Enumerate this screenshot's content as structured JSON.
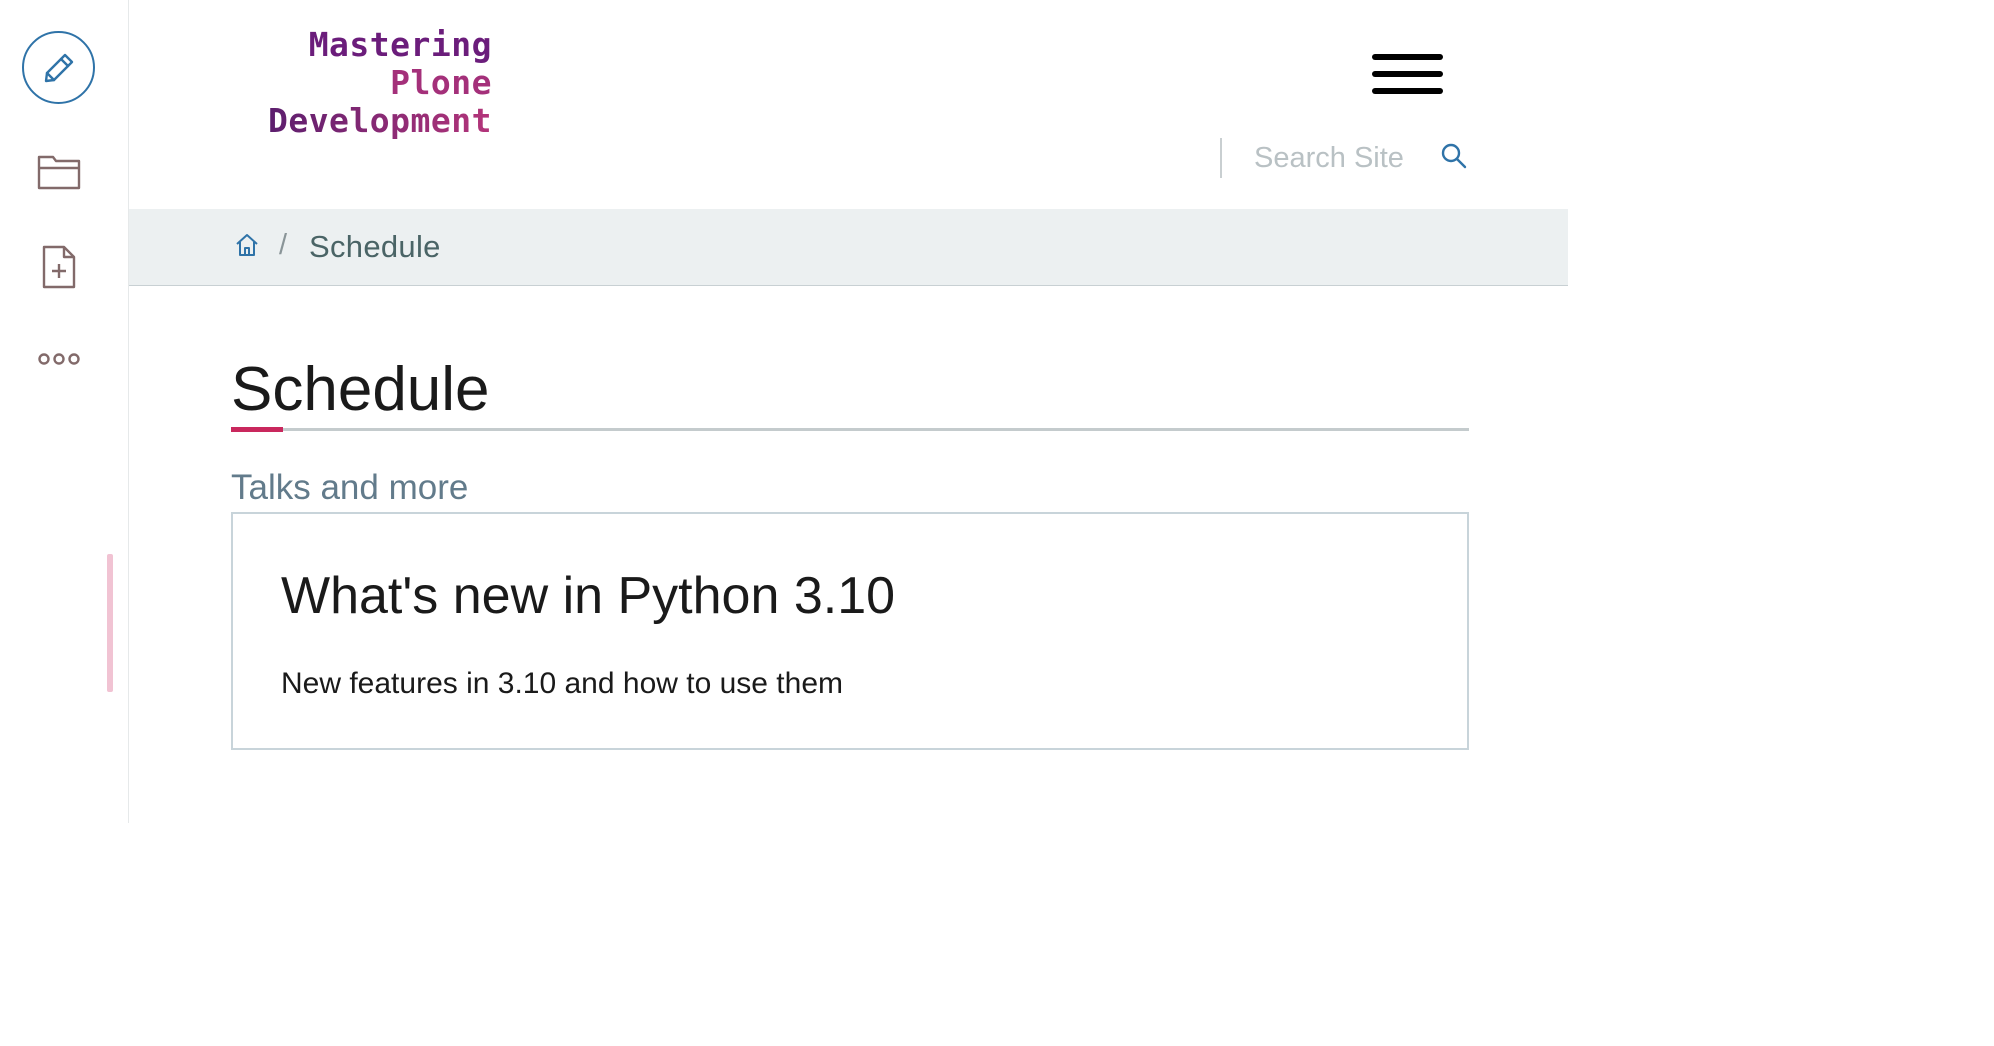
{
  "toolbar": {
    "edit_icon": "pencil-icon",
    "folder_icon": "folder-icon",
    "add_icon": "add-document-icon",
    "more_icon": "more-icon",
    "accent_color": "#2f73a8",
    "icon_color": "#826a6a"
  },
  "header": {
    "logo": {
      "line1": "Mastering",
      "line2": "Plone",
      "line3": "Development"
    },
    "menu_icon": "hamburger-icon",
    "search": {
      "placeholder": "Search Site",
      "icon": "search-icon"
    }
  },
  "breadcrumbs": {
    "home_icon": "home-icon",
    "separator": "/",
    "current": "Schedule"
  },
  "main": {
    "title": "Schedule",
    "accent_color": "#c9285d",
    "section_heading": "Talks and more",
    "listing": [
      {
        "title": "What's new in Python 3.10",
        "description": "New features in 3.10 and how to use them"
      }
    ]
  }
}
